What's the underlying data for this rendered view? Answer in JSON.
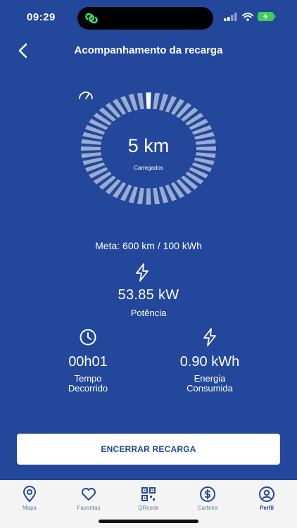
{
  "status_bar": {
    "time": "09:29"
  },
  "header": {
    "title": "Acompanhamento da recarga"
  },
  "gauge": {
    "value": "5 km",
    "label": "Carregados",
    "progress": 0.05
  },
  "goal": {
    "text": "Meta: 600 km / 100 kWh"
  },
  "power": {
    "value": "53.85 kW",
    "label": "Potência"
  },
  "elapsed": {
    "value": "00h01",
    "label_line1": "Tempo",
    "label_line2": "Decorrido"
  },
  "energy": {
    "value": "0.90 kWh",
    "label_line1": "Energia",
    "label_line2": "Consumida"
  },
  "actions": {
    "end_label": "ENCERRAR RECARGA"
  },
  "tabs": [
    {
      "label": "Mapa",
      "icon": "map-pin-icon"
    },
    {
      "label": "Favoritas",
      "icon": "heart-icon"
    },
    {
      "label": "QRcode",
      "icon": "qrcode-icon"
    },
    {
      "label": "Carteira",
      "icon": "dollar-icon"
    },
    {
      "label": "Perfil",
      "icon": "user-icon"
    }
  ],
  "colors": {
    "background": "#23479a",
    "accent": "#ffffff",
    "tabbar": "#f4f4f4"
  }
}
